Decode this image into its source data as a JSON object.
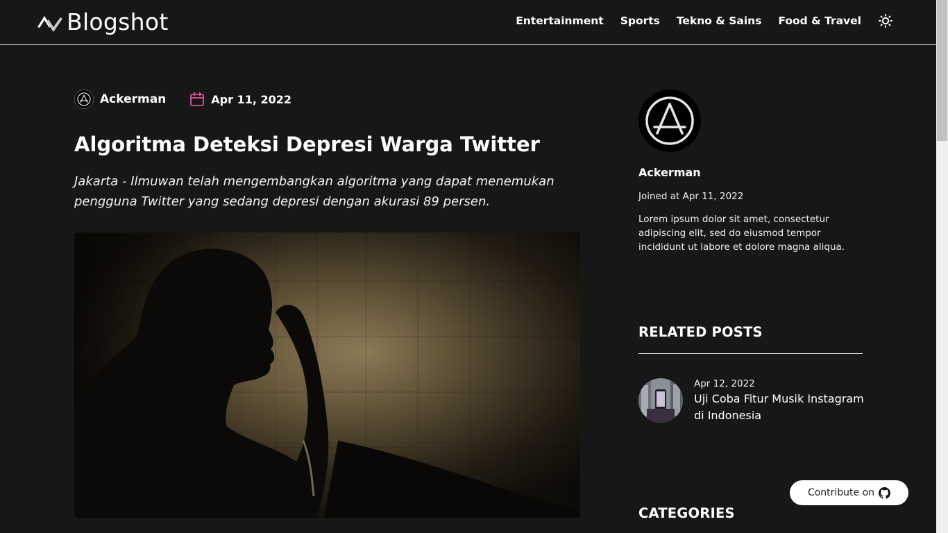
{
  "brand": {
    "name": "Blogshot"
  },
  "nav": {
    "items": [
      {
        "label": "Entertainment"
      },
      {
        "label": "Sports"
      },
      {
        "label": "Tekno & Sains"
      },
      {
        "label": "Food & Travel"
      }
    ],
    "theme_icon": "sun-icon"
  },
  "article": {
    "author": "Ackerman",
    "date": "Apr 11, 2022",
    "title": "Algoritma Deteksi Depresi Warga Twitter",
    "lead": "Jakarta - Ilmuwan telah mengembangkan algoritma yang dapat menemukan pengguna Twitter yang sedang depresi dengan akurasi 89 persen."
  },
  "sidebar": {
    "author_name": "Ackerman",
    "joined": "Joined at Apr 11, 2022",
    "bio": "Lorem ipsum dolor sit amet, consectetur adipiscing elit, sed do eiusmod tempor incididunt ut labore et dolore magna aliqua.",
    "related_title": "RELATED POSTS",
    "related": [
      {
        "date": "Apr 12, 2022",
        "title": "Uji Coba Fitur Musik Instagram di Indonesia"
      }
    ],
    "categories_title": "CATEGORIES"
  },
  "contribute": {
    "label": "Contribute on",
    "icon": "github-icon"
  },
  "colors": {
    "background": "#171717",
    "calendar_accent": "#e0559a",
    "text": "#ffffff"
  }
}
